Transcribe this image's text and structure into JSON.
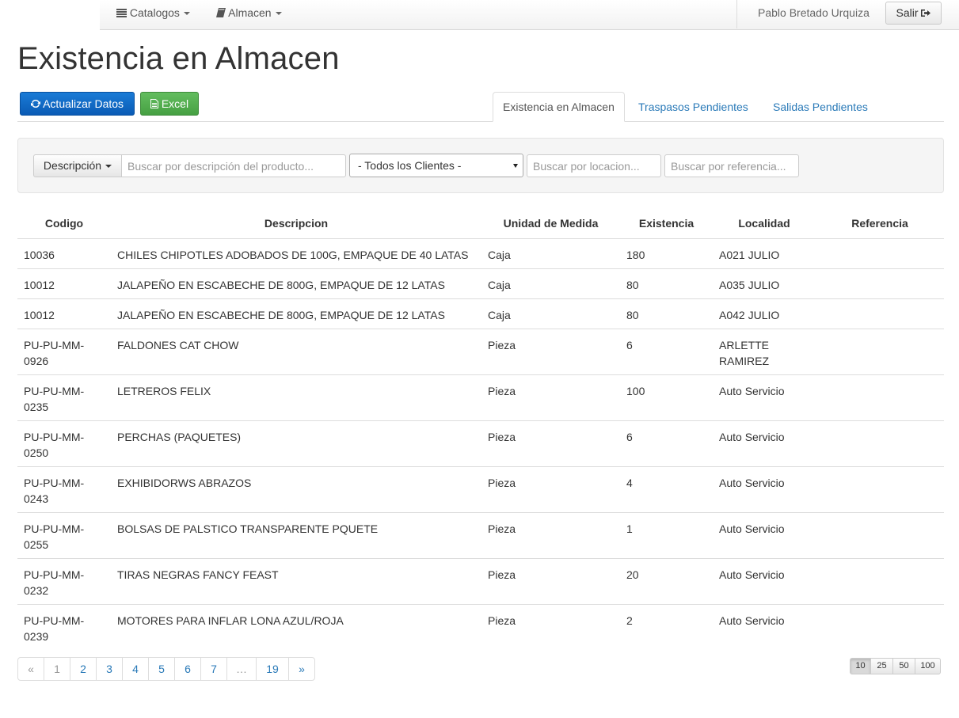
{
  "navbar": {
    "catalogos_label": "Catalogos",
    "almacen_label": "Almacen",
    "user_name": "Pablo Bretado Urquiza",
    "logout_label": "Salir"
  },
  "page": {
    "title": "Existencia en Almacen"
  },
  "toolbar": {
    "refresh_label": "Actualizar Datos",
    "excel_label": "Excel"
  },
  "tabs": [
    {
      "label": "Existencia en Almacen",
      "active": true
    },
    {
      "label": "Traspasos Pendientes",
      "active": false
    },
    {
      "label": "Salidas Pendientes",
      "active": false
    }
  ],
  "filters": {
    "search_field_label": "Descripción",
    "description_placeholder": "Buscar por descripción del producto...",
    "client_select_value": "- Todos los Clientes -",
    "location_placeholder": "Buscar por locacion...",
    "reference_placeholder": "Buscar por referencia..."
  },
  "table": {
    "headers": [
      "Codigo",
      "Descripcion",
      "Unidad de Medida",
      "Existencia",
      "Localidad",
      "Referencia"
    ],
    "rows": [
      {
        "codigo": "10036",
        "descripcion": "CHILES CHIPOTLES ADOBADOS DE 100G, EMPAQUE DE 40 LATAS",
        "unidad": "Caja",
        "existencia": "180",
        "localidad": "A021 JULIO",
        "referencia": ""
      },
      {
        "codigo": "10012",
        "descripcion": "JALAPEÑO EN ESCABECHE DE 800G, EMPAQUE DE 12 LATAS",
        "unidad": "Caja",
        "existencia": "80",
        "localidad": "A035 JULIO",
        "referencia": ""
      },
      {
        "codigo": "10012",
        "descripcion": "JALAPEÑO EN ESCABECHE DE 800G, EMPAQUE DE 12 LATAS",
        "unidad": "Caja",
        "existencia": "80",
        "localidad": "A042 JULIO",
        "referencia": ""
      },
      {
        "codigo": "PU-PU-MM-0926",
        "descripcion": "FALDONES CAT CHOW",
        "unidad": "Pieza",
        "existencia": "6",
        "localidad": "ARLETTE RAMIREZ",
        "referencia": ""
      },
      {
        "codigo": "PU-PU-MM-0235",
        "descripcion": "LETREROS FELIX",
        "unidad": "Pieza",
        "existencia": "100",
        "localidad": "Auto Servicio",
        "referencia": ""
      },
      {
        "codigo": "PU-PU-MM-0250",
        "descripcion": "PERCHAS (PAQUETES)",
        "unidad": "Pieza",
        "existencia": "6",
        "localidad": "Auto Servicio",
        "referencia": ""
      },
      {
        "codigo": "PU-PU-MM-0243",
        "descripcion": "EXHIBIDORWS ABRAZOS",
        "unidad": "Pieza",
        "existencia": "4",
        "localidad": "Auto Servicio",
        "referencia": ""
      },
      {
        "codigo": "PU-PU-MM-0255",
        "descripcion": "BOLSAS DE PALSTICO TRANSPARENTE PQUETE",
        "unidad": "Pieza",
        "existencia": "1",
        "localidad": "Auto Servicio",
        "referencia": ""
      },
      {
        "codigo": "PU-PU-MM-0232",
        "descripcion": "TIRAS NEGRAS FANCY FEAST",
        "unidad": "Pieza",
        "existencia": "20",
        "localidad": "Auto Servicio",
        "referencia": ""
      },
      {
        "codigo": "PU-PU-MM-0239",
        "descripcion": "MOTORES PARA INFLAR LONA AZUL/ROJA",
        "unidad": "Pieza",
        "existencia": "2",
        "localidad": "Auto Servicio",
        "referencia": ""
      }
    ]
  },
  "pagination": {
    "pages": [
      "«",
      "1",
      "2",
      "3",
      "4",
      "5",
      "6",
      "7",
      "…",
      "19",
      "»"
    ],
    "current": "1",
    "page_sizes": [
      "10",
      "25",
      "50",
      "100"
    ],
    "active_size": "10"
  },
  "colors": {
    "primary": "#0a5bb5",
    "success": "#46a043",
    "link": "#2a7ab8"
  }
}
